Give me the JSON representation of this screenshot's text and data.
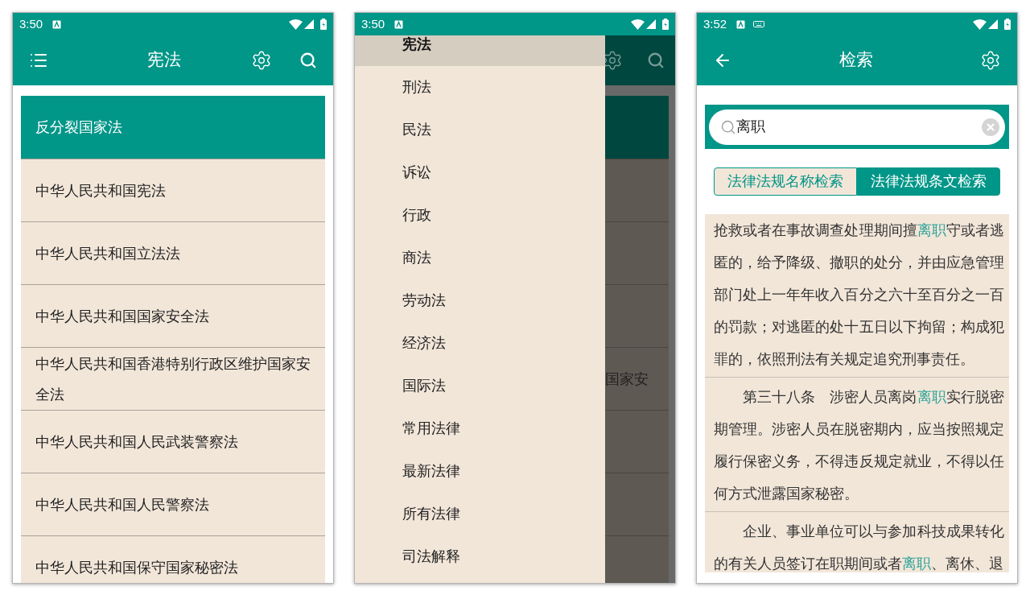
{
  "list_screen": {
    "status_bar": {
      "time": "3:50",
      "keyboard_indicator": false
    },
    "toolbar": {
      "title": "宪法"
    },
    "items": [
      {
        "label": "反分裂国家法",
        "selected": true
      },
      {
        "label": "中华人民共和国宪法",
        "selected": false
      },
      {
        "label": "中华人民共和国立法法",
        "selected": false
      },
      {
        "label": "中华人民共和国国家安全法",
        "selected": false
      },
      {
        "label": "中华人民共和国香港特别行政区维护国家安全法",
        "selected": false
      },
      {
        "label": "中华人民共和国人民武装警察法",
        "selected": false
      },
      {
        "label": "中华人民共和国人民警察法",
        "selected": false
      },
      {
        "label": "中华人民共和国保守国家秘密法",
        "selected": false
      }
    ]
  },
  "drawer_screen": {
    "status_bar": {
      "time": "3:50",
      "keyboard_indicator": false
    },
    "drawer_items": [
      {
        "label": "宪法",
        "selected": true
      },
      {
        "label": "刑法",
        "selected": false
      },
      {
        "label": "民法",
        "selected": false
      },
      {
        "label": "诉讼",
        "selected": false
      },
      {
        "label": "行政",
        "selected": false
      },
      {
        "label": "商法",
        "selected": false
      },
      {
        "label": "劳动法",
        "selected": false
      },
      {
        "label": "经济法",
        "selected": false
      },
      {
        "label": "国际法",
        "selected": false
      },
      {
        "label": "常用法律",
        "selected": false
      },
      {
        "label": "最新法律",
        "selected": false
      },
      {
        "label": "所有法律",
        "selected": false
      },
      {
        "label": "司法解释",
        "selected": false
      }
    ],
    "behind_rows": [
      {
        "selected": true
      },
      {
        "selected": false
      },
      {
        "selected": false
      },
      {
        "selected": false
      },
      {
        "selected": false,
        "text": "国家安"
      },
      {
        "selected": false
      },
      {
        "selected": false
      },
      {
        "selected": false
      }
    ]
  },
  "search_screen": {
    "status_bar": {
      "time": "3:52",
      "keyboard_indicator": true
    },
    "toolbar": {
      "title": "检索"
    },
    "search": {
      "value": "离职"
    },
    "tabs": [
      {
        "label": "法律法规名称检索",
        "selected": false
      },
      {
        "label": "法律法规条文检索",
        "selected": true
      }
    ],
    "results": [
      {
        "indented": false,
        "segments": [
          {
            "text": "抢救或者在事故调查处理期间擅",
            "highlight": false
          },
          {
            "text": "离职",
            "highlight": true
          },
          {
            "text": "守或者逃匿的，给予降级、撤职的处分，并由应急管理部门处上一年年收入百分之六十至百分之一百的罚款；对逃匿的处十五日以下拘留；构成犯罪的，依照刑法有关规定追究刑事责任。",
            "highlight": false
          }
        ]
      },
      {
        "indented": true,
        "segments": [
          {
            "text": "第三十八条　涉密人员离岗",
            "highlight": false
          },
          {
            "text": "离职",
            "highlight": true
          },
          {
            "text": "实行脱密期管理。涉密人员在脱密期内，应当按照规定履行保密义务，不得违反规定就业，不得以任何方式泄露国家秘密。",
            "highlight": false
          }
        ]
      },
      {
        "indented": true,
        "segments": [
          {
            "text": "企业、事业单位可以与参加科技成果转化的有关人员签订在职期间或者",
            "highlight": false
          },
          {
            "text": "离职",
            "highlight": true
          },
          {
            "text": "、离休、退",
            "highlight": false
          }
        ]
      }
    ]
  }
}
